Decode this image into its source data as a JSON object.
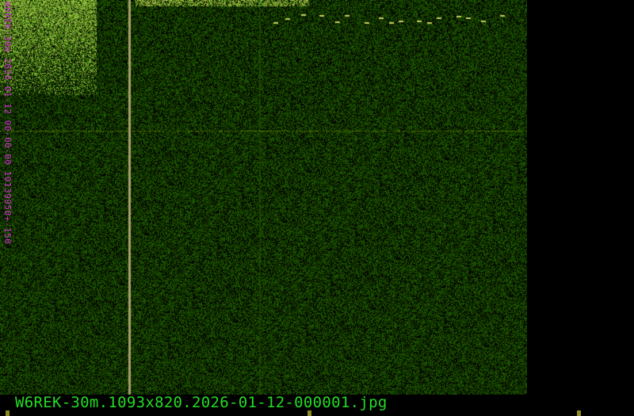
{
  "viewer": {
    "filename": "W6REK-30m.1093x820.2026-01-12-000001.jpg",
    "image_label": "W6REK-30m 2026-01-12 00-00-00 10139950+-150",
    "colors": {
      "background": "#000000",
      "noise": "#2a5a10",
      "signal": "#a8d040",
      "filename_text": "#22dd22",
      "label_text": "#d030d0"
    }
  }
}
